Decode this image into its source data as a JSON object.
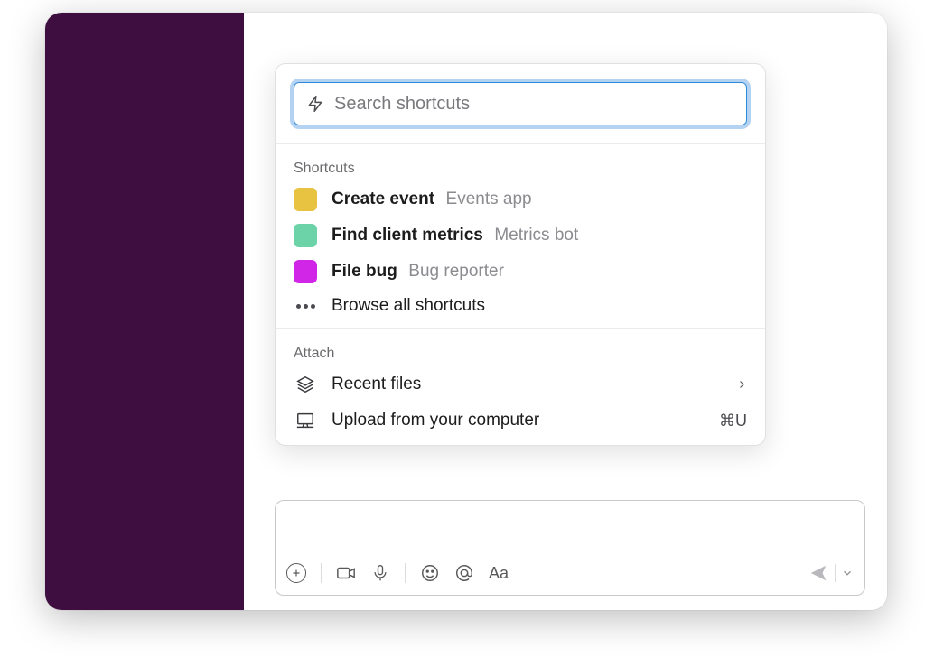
{
  "colors": {
    "sidebar_bg": "#3f0e40",
    "swatch_yellow": "#e8c241",
    "swatch_green": "#6cd3a8",
    "swatch_magenta": "#d126e8",
    "focus_ring": "#2f8ad8"
  },
  "search": {
    "placeholder": "Search shortcuts"
  },
  "shortcuts": {
    "heading": "Shortcuts",
    "items": [
      {
        "title": "Create event",
        "subtitle": "Events app",
        "swatch": "#e8c241"
      },
      {
        "title": "Find client metrics",
        "subtitle": "Metrics bot",
        "swatch": "#6cd3a8"
      },
      {
        "title": "File bug",
        "subtitle": "Bug reporter",
        "swatch": "#d126e8"
      }
    ],
    "browse_label": "Browse all shortcuts"
  },
  "attach": {
    "heading": "Attach",
    "recent_label": "Recent files",
    "upload_label": "Upload from your computer",
    "upload_shortcut": "⌘U"
  },
  "composer": {
    "tooltips": {
      "add": "Add",
      "video": "Video",
      "audio": "Audio",
      "emoji": "Emoji",
      "mention": "Mention",
      "format": "Formatting",
      "send": "Send",
      "send_options": "Send options"
    }
  }
}
